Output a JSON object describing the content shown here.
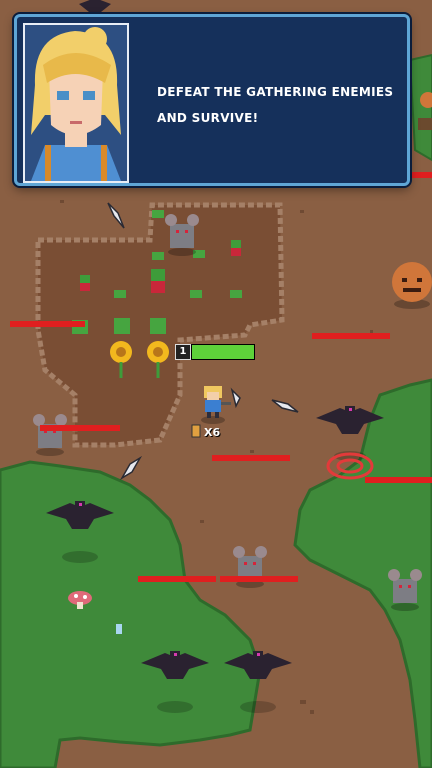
{
  "dialog": {
    "message": "DEFEAT THE GATHERING ENEMIES AND SURVIVE!"
  },
  "hud": {
    "player_level": "1",
    "hp_fraction": 1.0,
    "ammo_multiplier": "X6"
  },
  "entities": {
    "enemies": [
      "rat",
      "rat",
      "rat",
      "rat",
      "crow",
      "crow",
      "crow",
      "crow",
      "crow",
      "pumpkin"
    ],
    "items": [
      "feather",
      "feather",
      "feather",
      "feather",
      "mushroom"
    ]
  },
  "colors": {
    "dirt": "#8a5f43",
    "grass": "#3f8a3a",
    "garden_soil": "#7a4e34",
    "dialog_bg": "#15305b",
    "dialog_border": "#5fa6d6",
    "enemy_hp": "#e01f1f",
    "player_hp": "#5ed13a",
    "target_ring": "#e23a3a"
  }
}
